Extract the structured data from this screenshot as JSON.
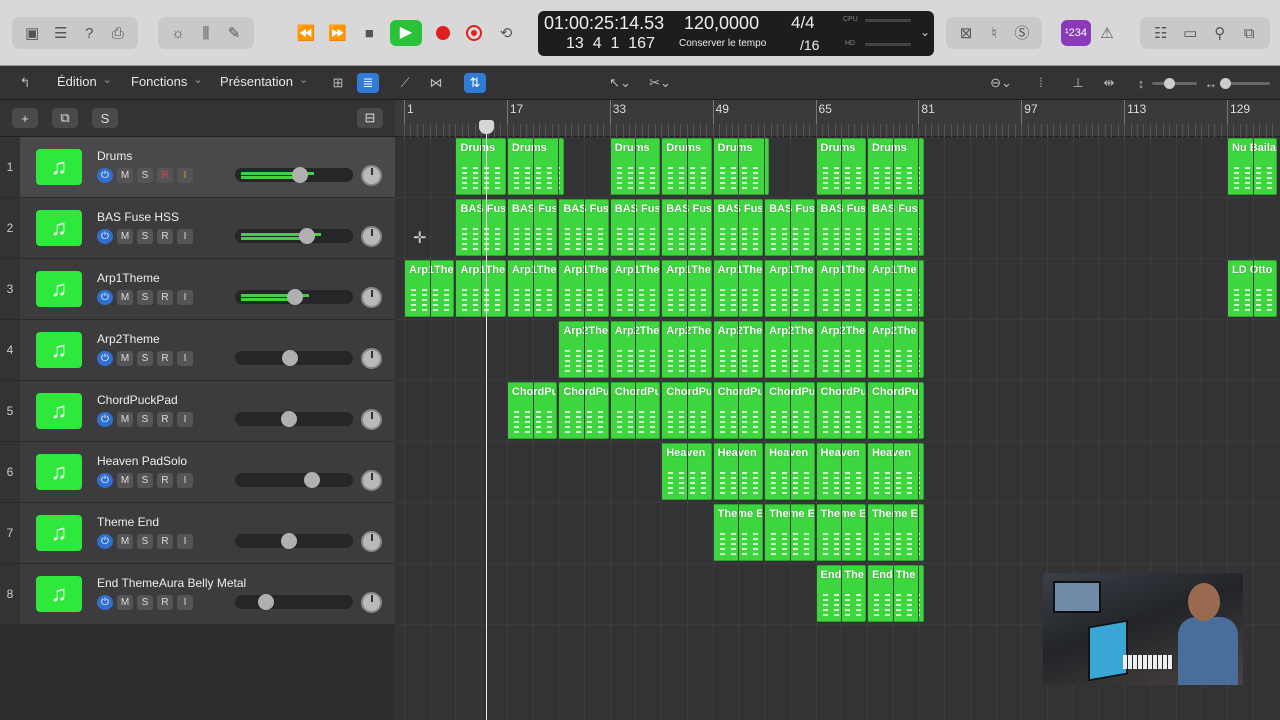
{
  "colors": {
    "region": "#3ed63e",
    "play": "#29c238",
    "record": "#e02020",
    "accent": "#2f7bd6",
    "badge": "#8a3ab9"
  },
  "lcd": {
    "time": "01:00:25:14.53",
    "position": "13  4  1  167",
    "tempo": "120,0000",
    "tempo_mode": "Conserver le tempo",
    "sig_top": "4/4",
    "sig_bottom": "/16",
    "cpu_label": "CPU",
    "hd_label": "HD"
  },
  "toolbar": {
    "badge": "¹234"
  },
  "menus": {
    "edition": "Édition",
    "fonctions": "Fonctions",
    "presentation": "Présentation"
  },
  "tracklist_header": {
    "solo_label": "S"
  },
  "track_buttons": {
    "mute": "M",
    "solo": "S",
    "record": "R",
    "input": "I"
  },
  "ruler": {
    "bars": [
      "1",
      "17",
      "33",
      "49",
      "65",
      "81",
      "97",
      "113",
      "129"
    ]
  },
  "tracks": [
    {
      "number": "1",
      "name": "Drums",
      "volume": 0.55
    },
    {
      "number": "2",
      "name": "BAS Fuse HSS",
      "volume": 0.62
    },
    {
      "number": "3",
      "name": "Arp1Theme",
      "volume": 0.5
    },
    {
      "number": "4",
      "name": "Arp2Theme",
      "volume": 0.45
    },
    {
      "number": "5",
      "name": "ChordPuckPad",
      "volume": 0.44
    },
    {
      "number": "6",
      "name": "Heaven PadSolo",
      "volume": 0.68
    },
    {
      "number": "7",
      "name": "Theme End",
      "volume": 0.44
    },
    {
      "number": "8",
      "name": "End ThemeAura Belly Metal",
      "volume": 0.2
    }
  ],
  "regions": [
    [
      {
        "label": "Drums",
        "bar": 9,
        "len": 8
      },
      {
        "label": "Drums",
        "bar": 17,
        "len": 9
      },
      {
        "label": "Drums",
        "bar": 33,
        "len": 8
      },
      {
        "label": "Drums",
        "bar": 41,
        "len": 8
      },
      {
        "label": "Drums",
        "bar": 49,
        "len": 9
      },
      {
        "label": "Drums",
        "bar": 65,
        "len": 8
      },
      {
        "label": "Drums",
        "bar": 73,
        "len": 9
      },
      {
        "label": "Nu Baila",
        "bar": 129,
        "len": 8
      }
    ],
    [
      {
        "label": "BAS Fus",
        "bar": 9,
        "len": 8
      },
      {
        "label": "BAS Fus",
        "bar": 17,
        "len": 8
      },
      {
        "label": "BAS Fus",
        "bar": 25,
        "len": 8
      },
      {
        "label": "BAS Fus",
        "bar": 33,
        "len": 8
      },
      {
        "label": "BAS Fus",
        "bar": 41,
        "len": 8
      },
      {
        "label": "BAS Fus",
        "bar": 49,
        "len": 8
      },
      {
        "label": "BAS Fus",
        "bar": 57,
        "len": 8
      },
      {
        "label": "BAS Fus",
        "bar": 65,
        "len": 8
      },
      {
        "label": "BAS Fus",
        "bar": 73,
        "len": 9
      }
    ],
    [
      {
        "label": "Arp1The",
        "bar": 1,
        "len": 8
      },
      {
        "label": "Arp1The",
        "bar": 9,
        "len": 8
      },
      {
        "label": "Arp1The",
        "bar": 17,
        "len": 8
      },
      {
        "label": "Arp1The",
        "bar": 25,
        "len": 8
      },
      {
        "label": "Arp1The",
        "bar": 33,
        "len": 8
      },
      {
        "label": "Arp1The",
        "bar": 41,
        "len": 8
      },
      {
        "label": "Arp1The",
        "bar": 49,
        "len": 8
      },
      {
        "label": "Arp1The",
        "bar": 57,
        "len": 8
      },
      {
        "label": "Arp1The",
        "bar": 65,
        "len": 8
      },
      {
        "label": "Arp1The",
        "bar": 73,
        "len": 9
      },
      {
        "label": "LD Otto",
        "bar": 129,
        "len": 8
      }
    ],
    [
      {
        "label": "Arp2The",
        "bar": 25,
        "len": 8
      },
      {
        "label": "Arp2The",
        "bar": 33,
        "len": 8
      },
      {
        "label": "Arp2The",
        "bar": 41,
        "len": 8
      },
      {
        "label": "Arp2The",
        "bar": 49,
        "len": 8
      },
      {
        "label": "Arp2The",
        "bar": 57,
        "len": 8
      },
      {
        "label": "Arp2The",
        "bar": 65,
        "len": 8
      },
      {
        "label": "Arp2The",
        "bar": 73,
        "len": 9
      }
    ],
    [
      {
        "label": "ChordPu",
        "bar": 17,
        "len": 8
      },
      {
        "label": "ChordPu",
        "bar": 25,
        "len": 8
      },
      {
        "label": "ChordPu",
        "bar": 33,
        "len": 8
      },
      {
        "label": "ChordPu",
        "bar": 41,
        "len": 8
      },
      {
        "label": "ChordPu",
        "bar": 49,
        "len": 8
      },
      {
        "label": "ChordPu",
        "bar": 57,
        "len": 8
      },
      {
        "label": "ChordPu",
        "bar": 65,
        "len": 8
      },
      {
        "label": "ChordPu",
        "bar": 73,
        "len": 9
      }
    ],
    [
      {
        "label": "Heaven",
        "bar": 41,
        "len": 8
      },
      {
        "label": "Heaven",
        "bar": 49,
        "len": 8
      },
      {
        "label": "Heaven",
        "bar": 57,
        "len": 8
      },
      {
        "label": "Heaven",
        "bar": 65,
        "len": 8
      },
      {
        "label": "Heaven",
        "bar": 73,
        "len": 9
      }
    ],
    [
      {
        "label": "Theme E",
        "bar": 49,
        "len": 8
      },
      {
        "label": "Theme E",
        "bar": 57,
        "len": 8
      },
      {
        "label": "Theme E",
        "bar": 65,
        "len": 8
      },
      {
        "label": "Theme E",
        "bar": 73,
        "len": 9
      }
    ],
    [
      {
        "label": "End The",
        "bar": 65,
        "len": 8
      },
      {
        "label": "End The",
        "bar": 73,
        "len": 9
      }
    ]
  ],
  "playhead_bar": 13.7
}
